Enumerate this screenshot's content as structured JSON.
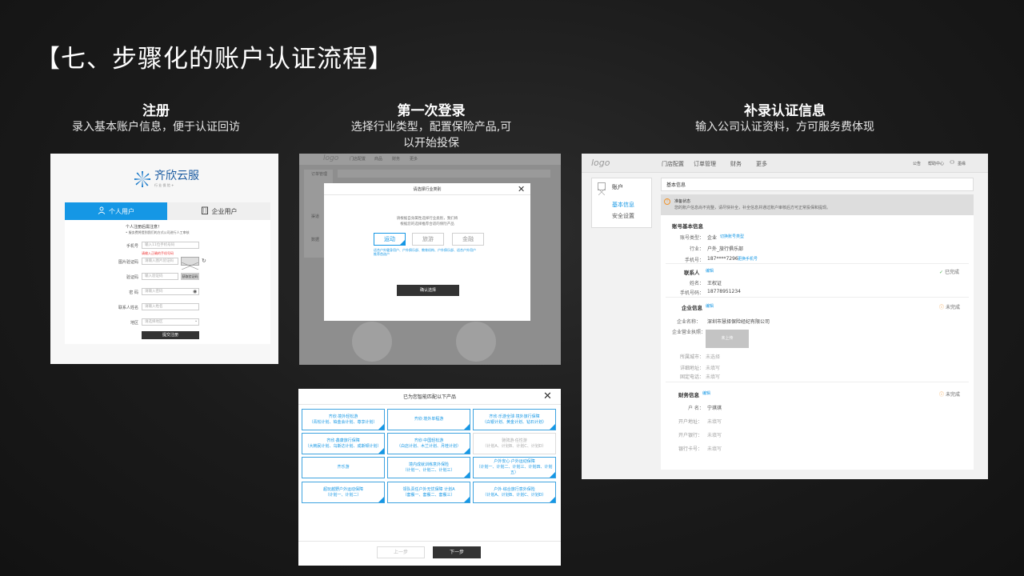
{
  "page_title": "【七、步骤化的账户认证流程】",
  "steps": [
    {
      "title": "注册",
      "subtitle": "录入基本账户信息，便于认证回访"
    },
    {
      "title": "第一次登录",
      "subtitle_line1": "选择行业类型，配置保险产品,可",
      "subtitle_line2": "以开始投保"
    },
    {
      "title": "补录认证信息",
      "subtitle": "输入公司认证资料，方可服务费体现"
    }
  ],
  "register": {
    "logo_text": "齐欣云服",
    "logo_sub": "行 业 保 险 +",
    "tab_personal": "个人用户",
    "tab_company": "企业用户",
    "note1": "个人注册后需注意！",
    "note2": "• 服务费将提到我们的方式公司进行人工审核",
    "phone_label": "手机号",
    "phone_placeholder": "输入11位手机号码",
    "phone_error": "请输入正确的手机号码",
    "captcha_label": "图片验证码",
    "captcha_placeholder": "请输入图片验证码",
    "sms_label": "验证码",
    "sms_placeholder": "输入验证码",
    "sms_button": "获取验证码",
    "pwd_label": "密 码",
    "pwd_placeholder": "请输入密码",
    "name_label": "联系人姓名",
    "name_placeholder": "请输入姓名",
    "region_label": "地区",
    "region_placeholder": "请选择地区",
    "submit": "提交注册"
  },
  "first_login": {
    "logo": "logo",
    "nav": [
      "门店配置",
      "商品",
      "财务",
      "更多"
    ],
    "sidebar": [
      "订单管理",
      "渠道",
      "数据"
    ],
    "dialog_title": "请选择行业类别",
    "dialog_desc1": "请根据自身属性选择行业类别，我们将",
    "dialog_desc2": "根据您的选择推荐合适的保险产品",
    "options": [
      "运动",
      "旅游",
      "金融"
    ],
    "hint1": "适合户外健身用户、户外俱乐部、教育机构、户外俱乐部、适合户外用户",
    "hint2": "推荐首选户",
    "confirm": "确认选择"
  },
  "products": {
    "title": "已为您智能匹配以下产品",
    "items": [
      [
        "齐欣·境外轻松游",
        "（青松计划、铂金会计划、尊享计划）"
      ],
      [
        "齐欣·境外单程游",
        ""
      ],
      [
        "齐欣·乐游全球·境外旅行保障",
        "（白银计划、黄金计划、钻石计划）"
      ],
      [
        "齐欣·鑫康旅行保障",
        "（大韩民计划、乌斯达计划、成斯顿计划）"
      ],
      [
        "齐欣·中国轻松游",
        "（白店计划、木兰计划、月桂计划）"
      ],
      [
        "驰骋游·任性游",
        "（计划A、计划B、计划C、计划D）"
      ],
      [
        "齐乐游",
        ""
      ],
      [
        "境内成就训练意外保险",
        "（计划一、计划二、计划三）"
      ],
      [
        "户外安心·户外运动保障",
        "（计划一、计划二、计划三、计划四、计划五）"
      ],
      [
        "超玩越野户外运动保障",
        "（计划一、计划二）"
      ],
      [
        "领队责任户外无忧保障 计划A",
        "（套餐一、套餐二、套餐三）"
      ],
      [
        "户外·综合旅行意外保险",
        "（计划A、计划B、计划C、计划D）"
      ]
    ],
    "prev": "上一步",
    "next": "下一步"
  },
  "supplement": {
    "logo": "logo",
    "nav": [
      "门店配置",
      "订单管理",
      "财务",
      "更多"
    ],
    "top_right": [
      "公告",
      "帮助中心",
      "墨缘"
    ],
    "side_title": "账户",
    "side_items": [
      "基本信息",
      "安全设置"
    ],
    "section_title": "基本信息",
    "alert_title": "准备状态",
    "alert_text": "您的账户信息尚不完整，请尽快补全，补全信息并通过账户审核后方可正常投保和提现。",
    "account_title": "账号基本信息",
    "account_type_label": "账号类型：",
    "account_type_value": "企业",
    "account_type_link": "切换账号类型",
    "industry_label": "行业：",
    "industry_value": "户外_旅行俱乐部",
    "mobile_label": "手机号：",
    "mobile_value": "187****7296",
    "mobile_link": "更换手机号",
    "contact_title": "联系人",
    "edit": "编辑",
    "done": "已完成",
    "undone": "未完成",
    "name_label": "姓名：",
    "name_value": "王权证",
    "contact_mobile_label": "手机号码：",
    "contact_mobile_value": "18778951234",
    "company_title": "企业信息",
    "company_name_label": "企业名称：",
    "company_name_value": "深圳市慧择保险经纪有限公司",
    "license_label": "企业营业执照：",
    "license_upload": "未上传",
    "city_label": "所属城市：",
    "city_value": "未选择",
    "address_label": "详细地址：",
    "address_value": "未填写",
    "phone_label": "固定电话：",
    "phone_value": "未填写",
    "finance_title": "财务信息",
    "holder_label": "户 名：",
    "holder_value": "宁琪琪",
    "bank_label": "开户地址：",
    "bank_value": "未填写",
    "branch_label": "开户银行：",
    "branch_value": "未填写",
    "card_label": "银行卡号：",
    "card_value": "未填写"
  }
}
